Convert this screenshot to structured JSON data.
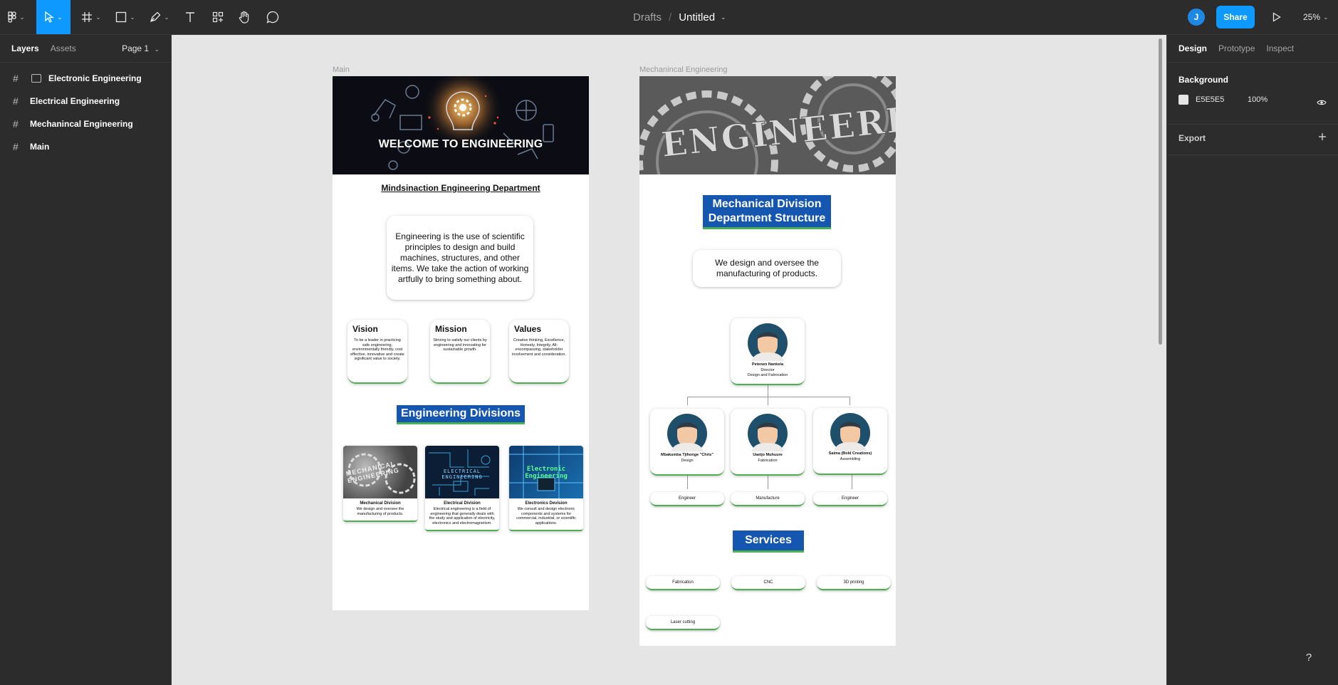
{
  "toolbar": {
    "file": {
      "crumb": "Drafts",
      "name": "Untitled"
    },
    "avatar_initial": "J",
    "share_label": "Share",
    "zoom": "25%"
  },
  "left_panel": {
    "tabs": [
      "Layers",
      "Assets"
    ],
    "page": "Page 1",
    "layers": [
      {
        "name": "Electronic Engineering"
      },
      {
        "name": "Electrical Engineering"
      },
      {
        "name": "Mechanincal Engineering"
      },
      {
        "name": "Main"
      }
    ]
  },
  "right_panel": {
    "tabs": [
      "Design",
      "Prototype",
      "Inspect"
    ],
    "background_label": "Background",
    "bg_hex": "E5E5E5",
    "bg_opacity": "100%",
    "export_label": "Export"
  },
  "help_label": "?",
  "main_frame": {
    "label": "Main",
    "hero_title": "WELCOME TO ENGINEERING",
    "dept_title": "Mindsinaction Engineering Department",
    "intro": "Engineering is the use of scientific principles to design and build machines, structures, and other items. We take the action of working artfully to bring something about.",
    "vmv": [
      {
        "title": "Vision",
        "text": "To be a leader in practicing safe engineering, environmentally friendly, cost effective, innovative and create significant value to society."
      },
      {
        "title": "Mission",
        "text": "Striving to satisfy our clients by engineering and innovating for sustainable growth."
      },
      {
        "title": "Values",
        "text": "Creative thinking, Excellence, Honesty, Integrity, All-encompassing, stakeholder involvement and consideration."
      }
    ],
    "divisions_heading": "Engineering Divisions",
    "divisions": [
      {
        "title": "Mechanical Division",
        "text": "We design and oversee the manufacturing of products.",
        "img_text": "MECHANICAL ENGINEERING"
      },
      {
        "title": "Electrical Division",
        "text": "Electrical engineering is a field of engineering that generally deals with the study and application of electricity, electronics and electromagnetism.",
        "img_text": "ELECTRICAL ENGINEERING"
      },
      {
        "title": "Electronics Devision",
        "text": "We consult and design electronic components and systems for commercial, industrial, or scientific applications.",
        "img_text": "Electronic Engineering"
      }
    ]
  },
  "mech_frame": {
    "label": "Mechanincal Engineering",
    "hero_text": "ENGINEERING",
    "heading_line1": "Mechanical Division",
    "heading_line2": "Department Structure",
    "intro": "We design and oversee the manufacturing of products.",
    "director": {
      "name": "Petenen Nankela",
      "role1": "Director",
      "role2": "Design and Fabrication"
    },
    "team": [
      {
        "name": "Mbakumba Tjihonge \"Chris\"",
        "role": "Design",
        "sub": "Engineer"
      },
      {
        "name": "Uaetjo Muhuure",
        "role": "Fabrication",
        "sub": "Manufacture"
      },
      {
        "name": "Saima (Bold Creations)",
        "role": "Assembling",
        "sub": "Engineer"
      }
    ],
    "services_heading": "Services",
    "services": [
      "Fabrication",
      "CNC",
      "3D printing",
      "Laser cutting"
    ]
  }
}
